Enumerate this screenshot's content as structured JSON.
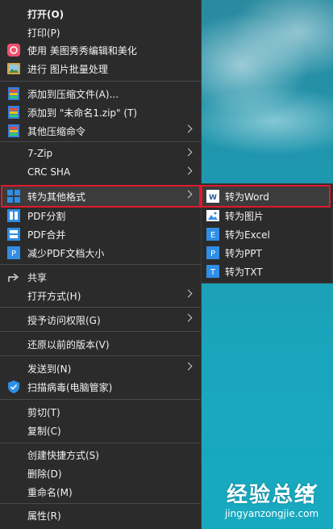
{
  "menu": {
    "open": "打开(O)",
    "print": "打印(P)",
    "meitu": "使用 美图秀秀编辑和美化",
    "batch": "进行 图片批量处理",
    "add_archive": "添加到压缩文件(A)...",
    "add_zip": "添加到 \"未命名1.zip\" (T)",
    "other_compress": "其他压缩命令",
    "sevenzip": "7-Zip",
    "crc": "CRC SHA",
    "convert": "转为其他格式",
    "pdf_split": "PDF分割",
    "pdf_merge": "PDF合并",
    "pdf_shrink": "减少PDF文档大小",
    "share": "共享",
    "open_with": "打开方式(H)",
    "grant_access": "授予访问权限(G)",
    "restore": "还原以前的版本(V)",
    "send_to": "发送到(N)",
    "scan": "扫描病毒(电脑管家)",
    "cut": "剪切(T)",
    "copy": "复制(C)",
    "create_shortcut": "创建快捷方式(S)",
    "delete": "删除(D)",
    "rename": "重命名(M)",
    "properties": "属性(R)"
  },
  "submenu": {
    "word": "转为Word",
    "image": "转为图片",
    "excel": "转为Excel",
    "ppt": "转为PPT",
    "txt": "转为TXT"
  },
  "watermark": {
    "title": "经验总结",
    "url": "jingyanzongjie.com"
  },
  "colors": {
    "menu_bg": "#2b2b2b",
    "highlight_border": "#e0192e",
    "desktop": "#1aa7bd"
  }
}
